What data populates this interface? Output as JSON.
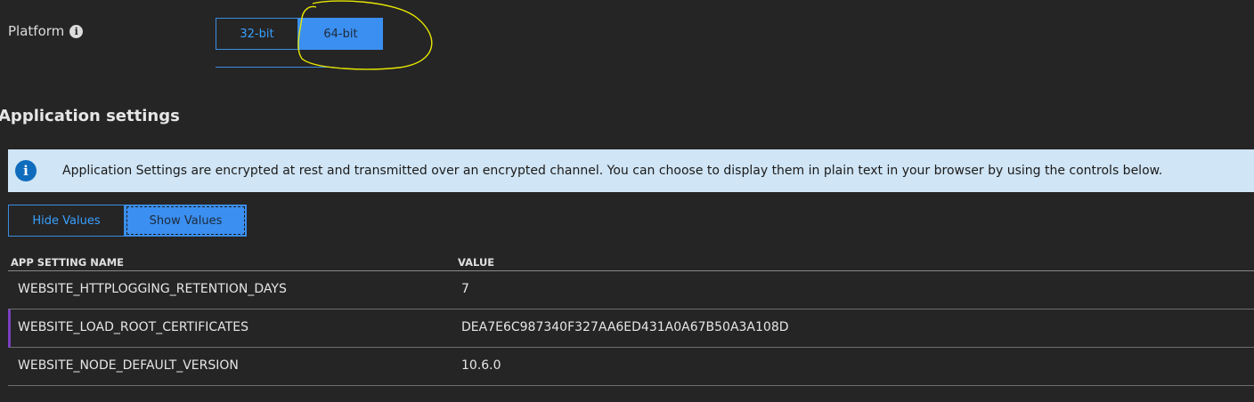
{
  "platform": {
    "label": "Platform",
    "info_icon": "info-icon",
    "options": [
      "32-bit",
      "64-bit"
    ],
    "selected": "64-bit"
  },
  "section": {
    "title": "Application settings"
  },
  "banner": {
    "icon": "info-icon",
    "text": "Application Settings are encrypted at rest and transmitted over an encrypted channel. You can choose to display them in plain text in your browser by using the controls below."
  },
  "values_toggle": {
    "hide_label": "Hide Values",
    "show_label": "Show Values",
    "selected": "Show Values"
  },
  "table": {
    "columns": [
      "APP SETTING NAME",
      "VALUE"
    ],
    "rows": [
      {
        "name": "WEBSITE_HTTPLOGGING_RETENTION_DAYS",
        "value": "7"
      },
      {
        "name": "WEBSITE_LOAD_ROOT_CERTIFICATES",
        "value": "DEA7E6C987340F327AA6ED431A0A67B50A3A108D"
      },
      {
        "name": "WEBSITE_NODE_DEFAULT_VERSION",
        "value": "10.6.0"
      }
    ]
  },
  "colors": {
    "background": "#252526",
    "accent": "#3b8ff0",
    "banner_bg": "#d0e5f5",
    "annotation": "#e6e600",
    "selected_row_marker": "#7a3fbf"
  }
}
